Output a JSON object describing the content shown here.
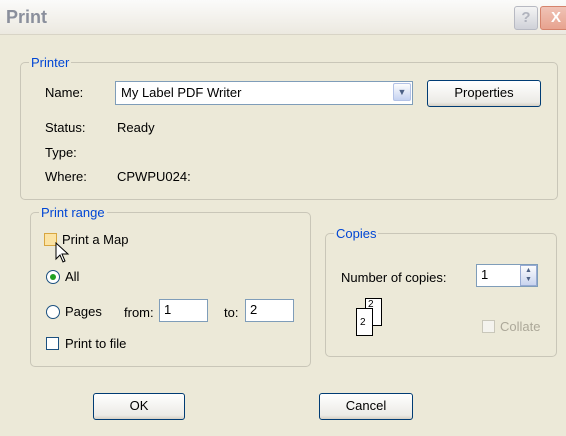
{
  "window": {
    "title": "Print",
    "help_glyph": "?",
    "close_glyph": "X"
  },
  "printer": {
    "legend": "Printer",
    "name_label": "Name:",
    "name_value": "My Label PDF Writer",
    "properties_label": "Properties",
    "status_label": "Status:",
    "status_value": "Ready",
    "type_label": "Type:",
    "type_value": "",
    "where_label": "Where:",
    "where_value": "CPWPU024:"
  },
  "print_range": {
    "legend": "Print range",
    "print_map_label": "Print a Map",
    "all_label": "All",
    "pages_label": "Pages",
    "from_label": "from:",
    "from_value": "1",
    "to_label": "to:",
    "to_value": "2",
    "print_to_file_label": "Print to file"
  },
  "copies": {
    "legend": "Copies",
    "number_label": "Number of copies:",
    "number_value": "1",
    "collate_label": "Collate",
    "page_back": "2",
    "page_front": "2"
  },
  "buttons": {
    "ok_label": "OK",
    "cancel_label": "Cancel"
  },
  "colors": {
    "legend": "#0046d5",
    "dialog_bg": "#ece9d8",
    "radio_dot": "#21a121"
  }
}
